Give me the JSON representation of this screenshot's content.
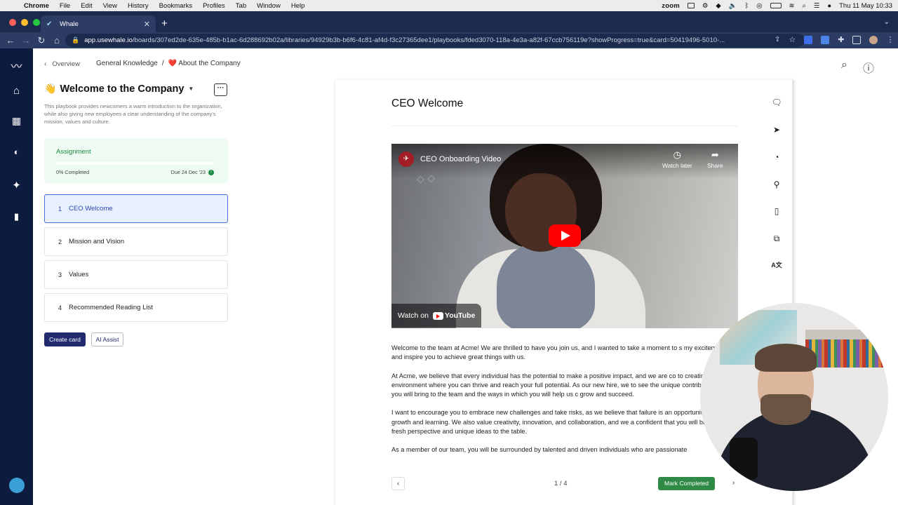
{
  "menubar": {
    "app": "Chrome",
    "items": [
      "File",
      "Edit",
      "View",
      "History",
      "Bookmarks",
      "Profiles",
      "Tab",
      "Window",
      "Help"
    ],
    "zoom": "zoom",
    "datetime": "Thu 11 May  10:33"
  },
  "browser": {
    "tab_title": "Whale",
    "url_host": "app.usewhale.io",
    "url_path": "/boards/307ed2de-635e-485b-b1ac-6d288692b02a/libraries/94929b3b-b6f6-4c81-af4d-f3c27365dee1/playbooks/fded3070-118a-4e3a-a82f-67ccb756119e?showProgress=true&card=50419496-5010-..."
  },
  "breadcrumb": {
    "back": "Overview",
    "path": [
      "General Knowledge",
      "/",
      "❤️ About the Company"
    ]
  },
  "playbook": {
    "emoji": "👋",
    "title": "Welcome to the Company",
    "description": "This playbook provides newcomers a warm introduction to the organization, while also giving new employees a clear understanding of the company's mission, values and culture."
  },
  "assignment": {
    "label": "Assignment",
    "progress_text": "0% Completed",
    "progress_fraction": 0,
    "due": "Due 24 Dec '23"
  },
  "cards": [
    {
      "num": "1",
      "label": "CEO Welcome"
    },
    {
      "num": "2",
      "label": "Mission and Vision"
    },
    {
      "num": "3",
      "label": "Values"
    },
    {
      "num": "4",
      "label": "Recommended Reading List"
    }
  ],
  "buttons": {
    "create": "Create card",
    "ai": "AI Assist",
    "mark": "Mark Completed"
  },
  "content": {
    "title": "CEO Welcome",
    "video": {
      "title": "CEO Onboarding Video",
      "watch_later": "Watch later",
      "share": "Share",
      "watch_on": "Watch on",
      "youtube": "YouTube"
    },
    "paragraphs": [
      "Welcome to the team at Acme! We are thrilled to have you join us, and I wanted to take a moment to s my excitement and inspire you to achieve great things with us.",
      "At Acme, we believe that every individual has the potential to make a positive impact, and we are co to creating an environment where you can thrive and reach your full potential. As our new hire, we to see the unique contributions you will bring to the team and the ways in which you will help us c grow and succeed.",
      "I want to encourage you to embrace new challenges and take risks, as we believe that failure is an opportunity for growth and learning. We also value creativity, innovation, and collaboration, and we a confident that you will bring a fresh perspective and unique ideas to the table.",
      "As a member of our team, you will be surrounded by talented and driven individuals who are passionate"
    ],
    "pager": "1 / 4"
  },
  "colors": {
    "sidebar": "#0d1b3e",
    "primary": "#1f2b6e",
    "success": "#2f8a45",
    "active_card": "#e8efff"
  }
}
